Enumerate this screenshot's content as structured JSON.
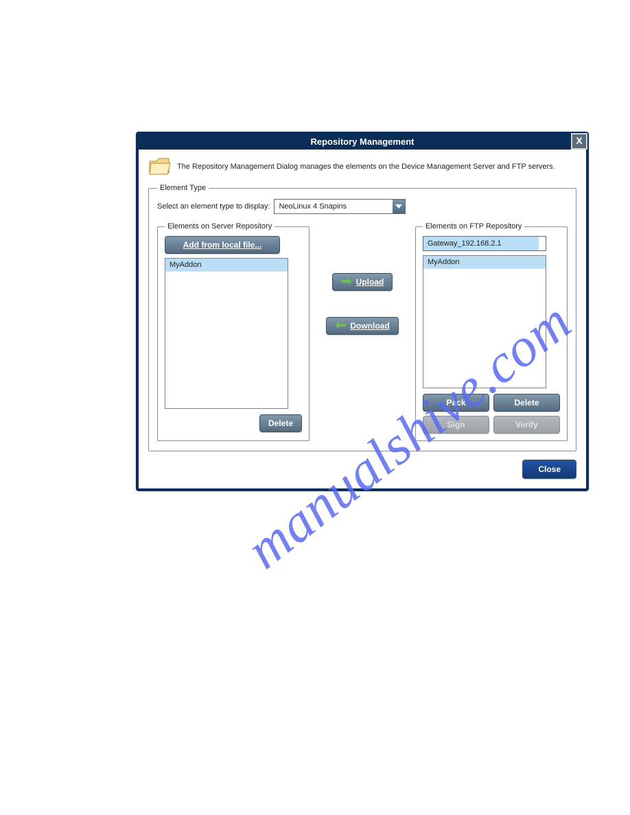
{
  "watermark": "manualshive.com",
  "dialog": {
    "title": "Repository Management",
    "intro": "The Repository Management Dialog manages the elements on the Device Management Server and FTP servers.",
    "close_x": "X"
  },
  "element_type": {
    "legend": "Element Type",
    "label": "Select an element type to display:",
    "selected": "NeoLinux 4 Snapins"
  },
  "server_repo": {
    "legend": "Elements on Server Repository",
    "add_button": "Add from local file...",
    "items": [
      "MyAddon"
    ],
    "delete_button": "Delete"
  },
  "transfer": {
    "upload": "Upload",
    "download": "Download"
  },
  "ftp_repo": {
    "legend": "Elements on FTP Repository",
    "gateway_selected": "Gateway_192.168.2.1",
    "items": [
      "MyAddon"
    ],
    "buttons": {
      "pack": "Pack",
      "delete": "Delete",
      "sign": "Sign",
      "verify": "Verify"
    }
  },
  "footer": {
    "close": "Close"
  }
}
